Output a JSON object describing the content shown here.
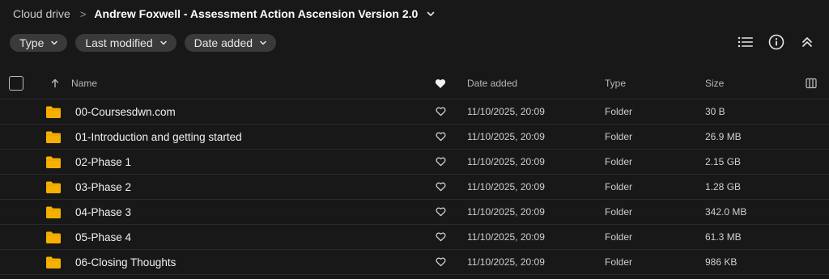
{
  "breadcrumb": {
    "root": "Cloud drive",
    "separator": ">",
    "current": "Andrew Foxwell - Assessment Action Ascension Version 2.0"
  },
  "filters": [
    {
      "label": "Type"
    },
    {
      "label": "Last modified"
    },
    {
      "label": "Date added"
    }
  ],
  "toolbar": {
    "list_view_icon": "list-view-icon",
    "info_icon": "info-icon",
    "collapse_icon": "collapse-icon"
  },
  "table": {
    "headers": {
      "name": "Name",
      "date_added": "Date added",
      "type": "Type",
      "size": "Size"
    },
    "rows": [
      {
        "name": "00-Coursesdwn.com",
        "date_added": "11/10/2025, 20:09",
        "type": "Folder",
        "size": "30 B"
      },
      {
        "name": "01-Introduction and getting started",
        "date_added": "11/10/2025, 20:09",
        "type": "Folder",
        "size": "26.9 MB"
      },
      {
        "name": "02-Phase 1",
        "date_added": "11/10/2025, 20:09",
        "type": "Folder",
        "size": "2.15 GB"
      },
      {
        "name": "03-Phase 2",
        "date_added": "11/10/2025, 20:09",
        "type": "Folder",
        "size": "1.28 GB"
      },
      {
        "name": "04-Phase 3",
        "date_added": "11/10/2025, 20:09",
        "type": "Folder",
        "size": "342.0 MB"
      },
      {
        "name": "05-Phase 4",
        "date_added": "11/10/2025, 20:09",
        "type": "Folder",
        "size": "61.3 MB"
      },
      {
        "name": "06-Closing Thoughts",
        "date_added": "11/10/2025, 20:09",
        "type": "Folder",
        "size": "986 KB"
      }
    ]
  },
  "colors": {
    "background": "#181818",
    "chip": "#3a3a3a",
    "folder": "#f6b100",
    "text": "#e6e6e6"
  }
}
